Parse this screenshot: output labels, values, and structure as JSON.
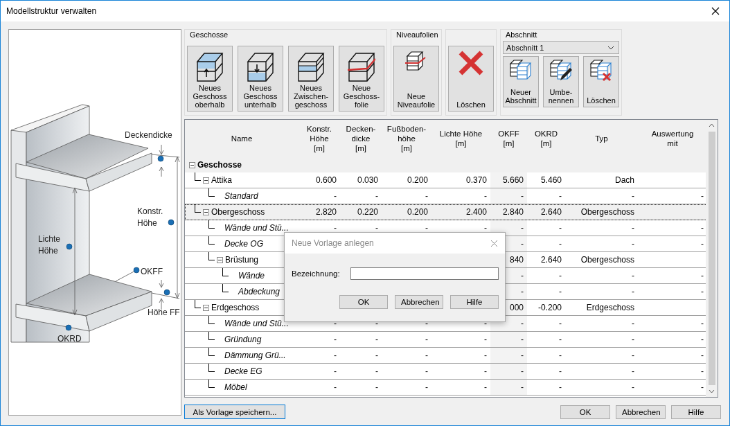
{
  "window": {
    "title": "Modellstruktur verwalten"
  },
  "illustration": {
    "labels": [
      {
        "text": "Deckendicke"
      },
      {
        "text": "Konstr. Höhe"
      },
      {
        "text": "Lichte Höhe"
      },
      {
        "text": "OKFF"
      },
      {
        "text": "Höhe FF"
      },
      {
        "text": "OKRD"
      }
    ]
  },
  "toolbar": {
    "groups": [
      {
        "title": "Geschosse",
        "buttons": [
          {
            "label": "Neues\nGeschoss\noberhalb"
          },
          {
            "label": "Neues\nGeschoss\nunterhalb"
          },
          {
            "label": "Neues\nZwischen-\ngeschoss"
          },
          {
            "label": "Neue\nGeschoss-\nfolie"
          }
        ]
      },
      {
        "title": "Niveaufolien",
        "buttons": [
          {
            "label": "Neue\nNiveaufolie"
          }
        ]
      },
      {
        "buttons": [
          {
            "label": "Löschen"
          }
        ]
      },
      {
        "title": "Abschnitt",
        "dropdown": {
          "value": "Abschnitt 1"
        },
        "buttons": [
          {
            "label": "Neuer\nAbschnitt"
          },
          {
            "label": "Umbe-\nnennen"
          },
          {
            "label": "Löschen"
          }
        ]
      }
    ]
  },
  "table": {
    "columns": [
      "Name",
      "Konstr.\nHöhe\n[m]",
      "Decken-\ndicke\n[m]",
      "Fußboden-\nhöhe\n[m]",
      "Lichte Höhe\n[m]",
      "OKFF\n[m]",
      "OKRD\n[m]",
      "Typ",
      "Auswertung\nmit"
    ],
    "rows": [
      {
        "name": "Geschosse",
        "kind": "group",
        "expanded": true,
        "selected": false,
        "children": [
          {
            "name": "Attika",
            "kind": "storey",
            "expanded": true,
            "selected": false,
            "cells": [
              "0.600",
              "0.030",
              "0.200",
              "0.370",
              "5.660",
              "5.460",
              "Dach",
              null
            ],
            "children": [
              {
                "name": "Standard",
                "kind": "part",
                "selected": false,
                "cells": [
                  "-",
                  "-",
                  "-",
                  "-",
                  "-",
                  "-",
                  "-",
                  "-"
                ]
              }
            ]
          },
          {
            "name": "Obergeschoss",
            "kind": "storey",
            "expanded": true,
            "selected": true,
            "cells": [
              "2.820",
              "0.220",
              "0.200",
              "2.400",
              "2.840",
              "2.640",
              "Obergeschoss",
              null
            ],
            "children": [
              {
                "name": "Wände und Stü...",
                "kind": "part",
                "selected": false,
                "cells": [
                  "-",
                  "-",
                  "-",
                  "-",
                  "-",
                  "-",
                  "-",
                  "-"
                ]
              },
              {
                "name": "Decke OG",
                "kind": "part",
                "selected": false,
                "cells": [
                  null,
                  null,
                  null,
                  null,
                  "-",
                  "-",
                  "-",
                  "-"
                ]
              },
              {
                "name": "Brüstung",
                "kind": "storey",
                "expanded": true,
                "selected": false,
                "cells": [
                  null,
                  null,
                  null,
                  null,
                  "840",
                  "2.640",
                  "Obergeschoss",
                  null
                ],
                "children": [
                  {
                    "name": "Wände",
                    "kind": "part",
                    "selected": false,
                    "cells": [
                      null,
                      null,
                      null,
                      null,
                      "-",
                      "-",
                      "-",
                      "-"
                    ]
                  },
                  {
                    "name": "Abdeckung",
                    "kind": "part",
                    "selected": false,
                    "cells": [
                      null,
                      null,
                      null,
                      null,
                      "-",
                      "-",
                      "-",
                      "-"
                    ]
                  }
                ]
              }
            ]
          },
          {
            "name": "Erdgeschoss",
            "kind": "storey",
            "expanded": true,
            "selected": false,
            "cells": [
              null,
              null,
              null,
              null,
              "000",
              "-0.200",
              "Erdgeschoss",
              null
            ],
            "children": [
              {
                "name": "Wände und Stü...",
                "kind": "part",
                "selected": false,
                "cells": [
                  "-",
                  "-",
                  "-",
                  "-",
                  "-",
                  "-",
                  "-",
                  "-"
                ]
              },
              {
                "name": "Gründung",
                "kind": "part",
                "selected": false,
                "cells": [
                  "-",
                  "-",
                  "-",
                  "-",
                  "-",
                  "-",
                  "-",
                  "-"
                ]
              },
              {
                "name": "Dämmung Grü...",
                "kind": "part",
                "selected": false,
                "cells": [
                  "-",
                  "-",
                  "-",
                  "-",
                  "-",
                  "-",
                  "-",
                  "-"
                ]
              },
              {
                "name": "Decke EG",
                "kind": "part",
                "selected": false,
                "cells": [
                  "-",
                  "-",
                  "-",
                  "-",
                  "-",
                  "-",
                  "-",
                  "-"
                ]
              },
              {
                "name": "Möbel",
                "kind": "part",
                "selected": false,
                "cells": [
                  "-",
                  "-",
                  "-",
                  "-",
                  "-",
                  "-",
                  "-",
                  "-"
                ]
              }
            ]
          }
        ]
      }
    ]
  },
  "dialog": {
    "title": "Neue Vorlage anlegen",
    "field_label": "Bezeichnung:",
    "buttons": [
      "OK",
      "Abbrechen",
      "Hilfe"
    ]
  },
  "footer": {
    "left_button": "Als Vorlage speichern...",
    "buttons": [
      "OK",
      "Abbrechen",
      "Hilfe"
    ]
  }
}
